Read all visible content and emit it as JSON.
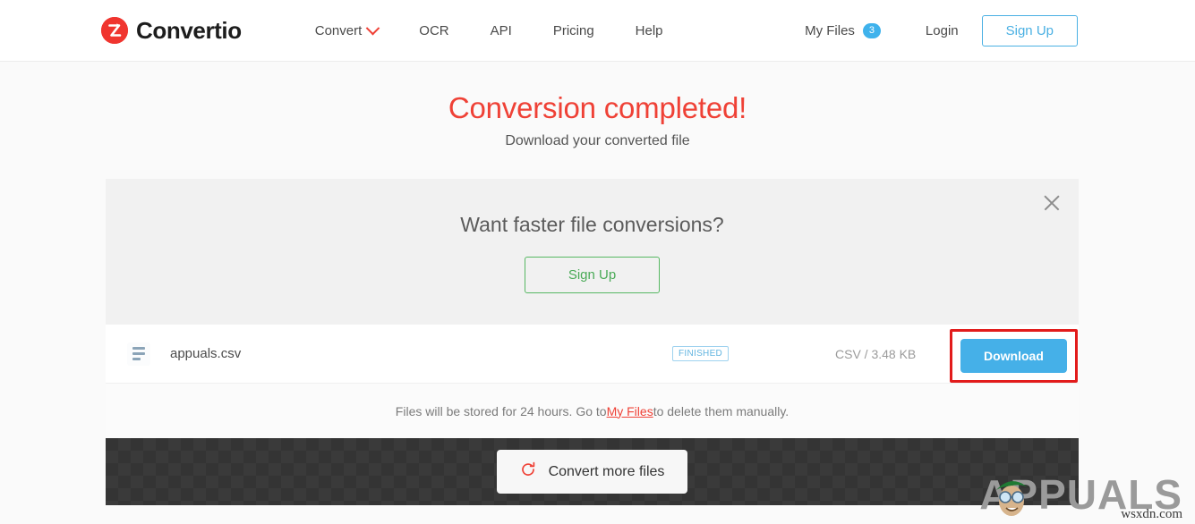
{
  "header": {
    "brand": "Convertio",
    "brand_icon": "convertio-logo-icon",
    "nav": [
      {
        "label": "Convert",
        "has_dropdown": true
      },
      {
        "label": "OCR",
        "has_dropdown": false
      },
      {
        "label": "API",
        "has_dropdown": false
      },
      {
        "label": "Pricing",
        "has_dropdown": false
      },
      {
        "label": "Help",
        "has_dropdown": false
      }
    ],
    "my_files_label": "My Files",
    "my_files_count": "3",
    "login_label": "Login",
    "signup_label": "Sign Up"
  },
  "hero": {
    "title": "Conversion completed!",
    "subtitle": "Download your converted file"
  },
  "promo": {
    "title": "Want faster file conversions?",
    "button_label": "Sign Up",
    "close_icon": "close-icon"
  },
  "file": {
    "icon": "file-lines-icon",
    "name": "appuals.csv",
    "status": "FINISHED",
    "meta": "CSV / 3.48 KB",
    "download_label": "Download"
  },
  "note": {
    "before": "Files will be stored for 24 hours. Go to ",
    "link": "My Files",
    "after": " to delete them manually."
  },
  "footer": {
    "convert_more_label": "Convert more files",
    "refresh_icon": "refresh-icon"
  },
  "watermark": {
    "text": "APPUALS",
    "site": "wsxdn.com"
  },
  "colors": {
    "brand_red": "#ef4136",
    "accent_blue": "#45b0e8",
    "badge_blue": "#3fb2ec",
    "green": "#57b863",
    "highlight_red": "#e21b1b",
    "page_bg": "#fafafa",
    "promo_bg": "#f1f1f1",
    "footer_dark": "#343434"
  }
}
